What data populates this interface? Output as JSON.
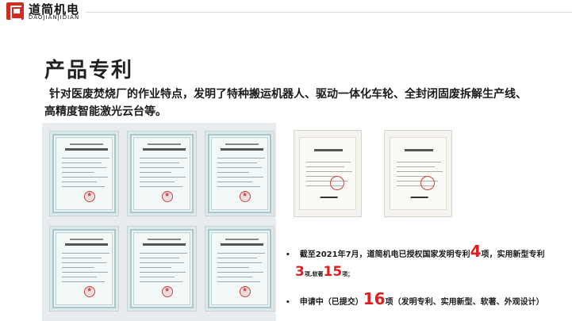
{
  "brand": {
    "name": "道简机电",
    "pinyin": "DAOJIANJIDIAN",
    "accent": "#d42a20"
  },
  "title": "产品专利",
  "intro": "针对医废焚烧厂的作业特点，发明了特种搬运机器人、驱动一体化车轮、全封闭固废拆解生产线、高精度智能激光云台等。",
  "bullets": [
    {
      "marker": "•",
      "prefix": "截至2021年7月，道简机电已授权国家发明专利",
      "invention_count": "4",
      "after_invention": "项，实用新型专利",
      "utility_count": "3",
      "utility_unit": "项,",
      "software_label": "软著",
      "software_count": "15",
      "end": "项；"
    },
    {
      "marker": "•",
      "prefix": "申请中（已提交）",
      "pending_count": "16",
      "suffix": "项（发明专利、实用新型、软著、外观设计）"
    }
  ],
  "colors": {
    "highlight": "#e02020",
    "text": "#1a1a1a"
  }
}
